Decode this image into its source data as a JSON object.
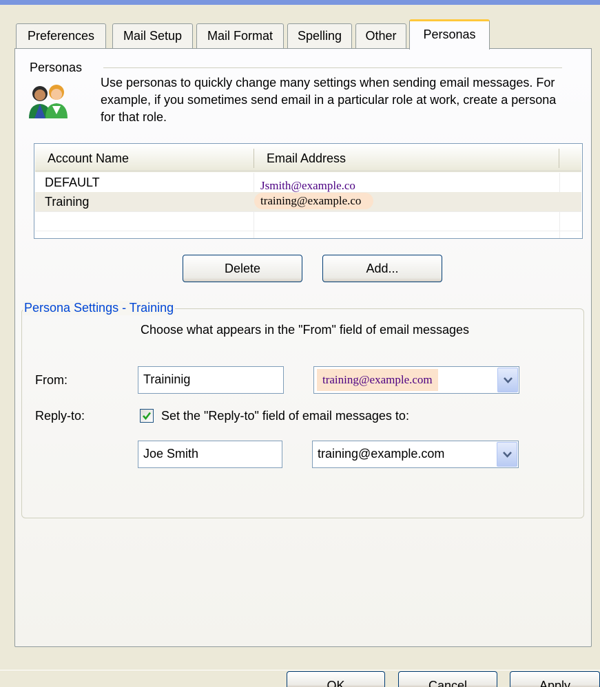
{
  "tabs": [
    "Preferences",
    "Mail Setup",
    "Mail Format",
    "Spelling",
    "Other",
    "Personas"
  ],
  "active_tab": "Personas",
  "personas": {
    "group_label": "Personas",
    "icon": "personas-icon",
    "description": "Use personas to quickly change many settings when sending email messages. For example, if you sometimes send email in a particular role at work, create a persona for that role."
  },
  "accounts_list": {
    "columns": [
      "Account Name",
      "Email Address"
    ],
    "rows": [
      {
        "name": "DEFAULT",
        "email": "Jsmith@example.co"
      },
      {
        "name": "Training",
        "email": "training@example.co"
      }
    ],
    "selected": "Training"
  },
  "buttons": {
    "delete": "Delete",
    "add": "Add..."
  },
  "persona_settings": {
    "legend": "Persona Settings - Training",
    "from_hint": "Choose what appears in the \"From\" field of email messages",
    "from_label": "From:",
    "from_name": "Traininig",
    "from_email": "training@example.com",
    "reply_label": "Reply-to:",
    "reply_checkbox_label": "Set the \"Reply-to\" field of email messages to:",
    "reply_checked": true,
    "reply_name": "Joe Smith",
    "reply_email": "training@example.com"
  },
  "footer": {
    "ok": "OK",
    "cancel": "Cancel",
    "apply": "Apply"
  },
  "colors": {
    "accent_tab": "#FFC83C",
    "legend_text": "#0046D5",
    "email_text": "#4B0082"
  }
}
